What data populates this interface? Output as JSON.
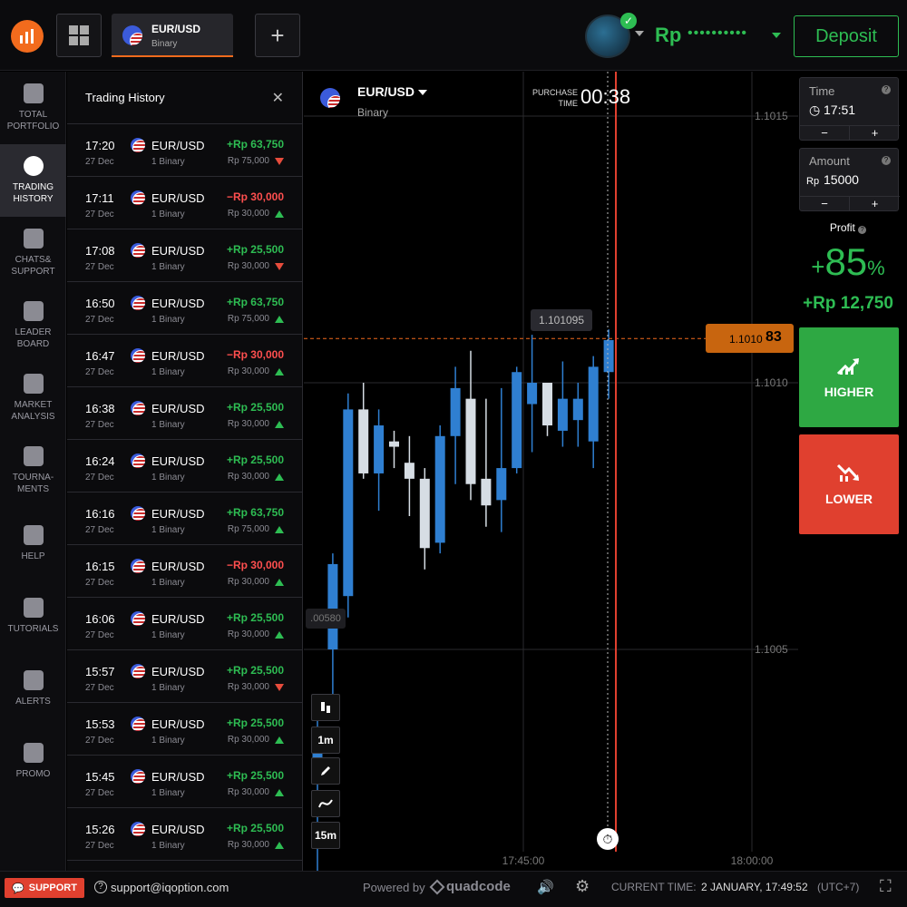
{
  "header": {
    "asset": "EUR/USD",
    "asset_type": "Binary",
    "currency": "Rp",
    "balance_masked": "••••••••••",
    "deposit_label": "Deposit",
    "add_label": "+"
  },
  "nav": {
    "items": [
      {
        "label": "TOTAL PORTFOLIO",
        "icon": "briefcase-icon"
      },
      {
        "label": "TRADING HISTORY",
        "icon": "clock-icon",
        "active": true
      },
      {
        "label": "CHATS& SUPPORT",
        "icon": "chat-icon"
      },
      {
        "label": "LEADER BOARD",
        "icon": "medal-icon"
      },
      {
        "label": "MARKET ANALYSIS",
        "icon": "chart-icon"
      },
      {
        "label": "TOURNA- MENTS",
        "icon": "trophy-icon"
      },
      {
        "label": "HELP",
        "icon": "question-icon"
      },
      {
        "label": "TUTORIALS",
        "icon": "graduation-cap-icon"
      },
      {
        "label": "ALERTS",
        "icon": "bell-icon"
      },
      {
        "label": "PROMO",
        "icon": "flame-icon"
      }
    ]
  },
  "history": {
    "title": "Trading History",
    "close": "✕",
    "rows": [
      {
        "time": "17:20",
        "date": "27 Dec",
        "pair": "EUR/USD",
        "type": "1 Binary",
        "pnl": "+Rp 63,750",
        "result": "win",
        "invest": "Rp 75,000",
        "dir": "down"
      },
      {
        "time": "17:11",
        "date": "27 Dec",
        "pair": "EUR/USD",
        "type": "1 Binary",
        "pnl": "−Rp 30,000",
        "result": "loss",
        "invest": "Rp 30,000",
        "dir": "up"
      },
      {
        "time": "17:08",
        "date": "27 Dec",
        "pair": "EUR/USD",
        "type": "1 Binary",
        "pnl": "+Rp 25,500",
        "result": "win",
        "invest": "Rp 30,000",
        "dir": "down"
      },
      {
        "time": "16:50",
        "date": "27 Dec",
        "pair": "EUR/USD",
        "type": "1 Binary",
        "pnl": "+Rp 63,750",
        "result": "win",
        "invest": "Rp 75,000",
        "dir": "up"
      },
      {
        "time": "16:47",
        "date": "27 Dec",
        "pair": "EUR/USD",
        "type": "1 Binary",
        "pnl": "−Rp 30,000",
        "result": "loss",
        "invest": "Rp 30,000",
        "dir": "up"
      },
      {
        "time": "16:38",
        "date": "27 Dec",
        "pair": "EUR/USD",
        "type": "1 Binary",
        "pnl": "+Rp 25,500",
        "result": "win",
        "invest": "Rp 30,000",
        "dir": "up"
      },
      {
        "time": "16:24",
        "date": "27 Dec",
        "pair": "EUR/USD",
        "type": "1 Binary",
        "pnl": "+Rp 25,500",
        "result": "win",
        "invest": "Rp 30,000",
        "dir": "up"
      },
      {
        "time": "16:16",
        "date": "27 Dec",
        "pair": "EUR/USD",
        "type": "1 Binary",
        "pnl": "+Rp 63,750",
        "result": "win",
        "invest": "Rp 75,000",
        "dir": "up"
      },
      {
        "time": "16:15",
        "date": "27 Dec",
        "pair": "EUR/USD",
        "type": "1 Binary",
        "pnl": "−Rp 30,000",
        "result": "loss",
        "invest": "Rp 30,000",
        "dir": "up"
      },
      {
        "time": "16:06",
        "date": "27 Dec",
        "pair": "EUR/USD",
        "type": "1 Binary",
        "pnl": "+Rp 25,500",
        "result": "win",
        "invest": "Rp 30,000",
        "dir": "up"
      },
      {
        "time": "15:57",
        "date": "27 Dec",
        "pair": "EUR/USD",
        "type": "1 Binary",
        "pnl": "+Rp 25,500",
        "result": "win",
        "invest": "Rp 30,000",
        "dir": "down"
      },
      {
        "time": "15:53",
        "date": "27 Dec",
        "pair": "EUR/USD",
        "type": "1 Binary",
        "pnl": "+Rp 25,500",
        "result": "win",
        "invest": "Rp 30,000",
        "dir": "up"
      },
      {
        "time": "15:45",
        "date": "27 Dec",
        "pair": "EUR/USD",
        "type": "1 Binary",
        "pnl": "+Rp 25,500",
        "result": "win",
        "invest": "Rp 30,000",
        "dir": "up"
      },
      {
        "time": "15:26",
        "date": "27 Dec",
        "pair": "EUR/USD",
        "type": "1 Binary",
        "pnl": "+Rp 25,500",
        "result": "win",
        "invest": "Rp 30,000",
        "dir": "up"
      }
    ]
  },
  "chart": {
    "asset": "EUR/USD",
    "asset_type": "Binary",
    "purchase_label": "PURCHASE TIME",
    "purchase_time": "00:38",
    "price_levels": [
      "1.1015",
      "1.1010",
      "1.1005"
    ],
    "time_labels": [
      "17:45:00",
      "18:00:00"
    ],
    "current_price_prefix": "1.1010",
    "current_price_suffix": "83",
    "bubble_high": "1.101095",
    "bubble_low": ".00580",
    "tools": [
      "1m",
      "15m"
    ],
    "colors": {
      "up": "#2f7fd1",
      "down": "#d6dde4",
      "deadline": "#e0402f",
      "price": "#f26b1d"
    }
  },
  "chart_data": {
    "type": "candlestick",
    "yticks": [
      1.1005,
      1.101,
      1.1015
    ],
    "xticks": [
      "17:45:00",
      "18:00:00"
    ],
    "current_price": 1.101083,
    "candles": [
      {
        "o": 1.10028,
        "h": 1.10038,
        "l": 1.09998,
        "c": 1.10033
      },
      {
        "o": 1.1005,
        "h": 1.10068,
        "l": 1.1004,
        "c": 1.10066
      },
      {
        "o": 1.1006,
        "h": 1.10098,
        "l": 1.10056,
        "c": 1.10095
      },
      {
        "o": 1.10095,
        "h": 1.101,
        "l": 1.10082,
        "c": 1.10083
      },
      {
        "o": 1.10083,
        "h": 1.10095,
        "l": 1.10076,
        "c": 1.10092
      },
      {
        "o": 1.10089,
        "h": 1.10091,
        "l": 1.10084,
        "c": 1.10088
      },
      {
        "o": 1.10085,
        "h": 1.1009,
        "l": 1.10075,
        "c": 1.10082
      },
      {
        "o": 1.10082,
        "h": 1.10084,
        "l": 1.10065,
        "c": 1.10069
      },
      {
        "o": 1.1007,
        "h": 1.10092,
        "l": 1.10068,
        "c": 1.1009
      },
      {
        "o": 1.1009,
        "h": 1.10103,
        "l": 1.10081,
        "c": 1.10099
      },
      {
        "o": 1.10097,
        "h": 1.10106,
        "l": 1.10078,
        "c": 1.10081
      },
      {
        "o": 1.10082,
        "h": 1.10097,
        "l": 1.10073,
        "c": 1.10077
      },
      {
        "o": 1.10078,
        "h": 1.10099,
        "l": 1.10072,
        "c": 1.10084
      },
      {
        "o": 1.10084,
        "h": 1.10103,
        "l": 1.10083,
        "c": 1.10102
      },
      {
        "o": 1.10096,
        "h": 1.10109,
        "l": 1.10087,
        "c": 1.101
      },
      {
        "o": 1.101,
        "h": 1.101,
        "l": 1.1009,
        "c": 1.10092
      },
      {
        "o": 1.10091,
        "h": 1.10104,
        "l": 1.10088,
        "c": 1.10097
      },
      {
        "o": 1.10093,
        "h": 1.101,
        "l": 1.10088,
        "c": 1.10097
      },
      {
        "o": 1.10089,
        "h": 1.10105,
        "l": 1.10084,
        "c": 1.10103
      },
      {
        "o": 1.10102,
        "h": 1.1011,
        "l": 1.10097,
        "c": 1.10108
      }
    ]
  },
  "trade": {
    "time_label": "Time",
    "time_value": "17:51",
    "amount_label": "Amount",
    "amount_currency": "Rp",
    "amount_value": "15000",
    "minus": "−",
    "plus": "+",
    "profit_label": "Profit",
    "profit_pct_sign": "+",
    "profit_pct": "85",
    "profit_pct_unit": "%",
    "profit_amount": "+Rp 12,750",
    "higher_label": "HIGHER",
    "lower_label": "LOWER"
  },
  "footer": {
    "support_label": "SUPPORT",
    "email": "support@iqoption.com",
    "powered_by": "Powered by",
    "brand": "quadcode",
    "current_time_label": "CURRENT TIME:",
    "current_time": "2 JANUARY, 17:49:52",
    "tz": "(UTC+7)"
  }
}
